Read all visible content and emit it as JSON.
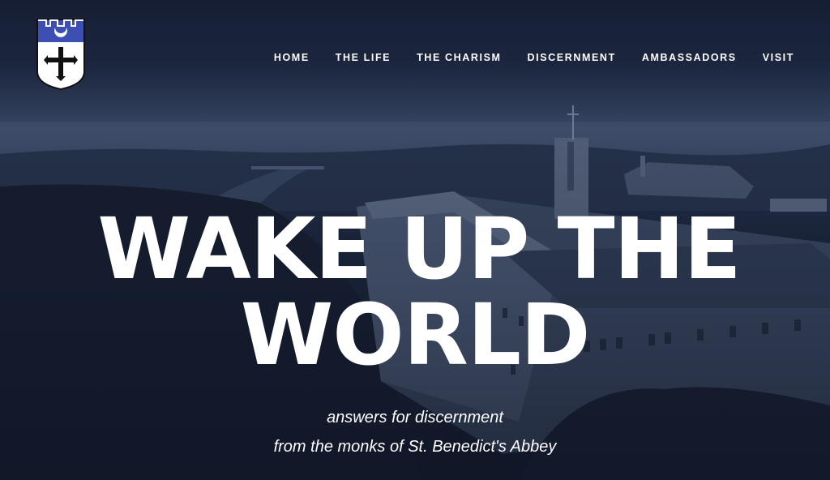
{
  "logo": {
    "icon": "abbey-shield-icon",
    "alt": ""
  },
  "nav": {
    "items": [
      {
        "label": "HOME"
      },
      {
        "label": "THE LIFE"
      },
      {
        "label": "THE CHARISM"
      },
      {
        "label": "DISCERNMENT"
      },
      {
        "label": "AMBASSADORS"
      },
      {
        "label": "VISIT"
      }
    ]
  },
  "hero": {
    "headline_line1": "WAKE UP THE",
    "headline_line2": "WORLD",
    "subtitle_line1": "answers for discernment",
    "subtitle_line2": "from the monks of St. Benedict's Abbey"
  },
  "colors": {
    "overlay": "#1a2338",
    "shield_blue": "#3d4fb3",
    "text": "#ffffff"
  }
}
